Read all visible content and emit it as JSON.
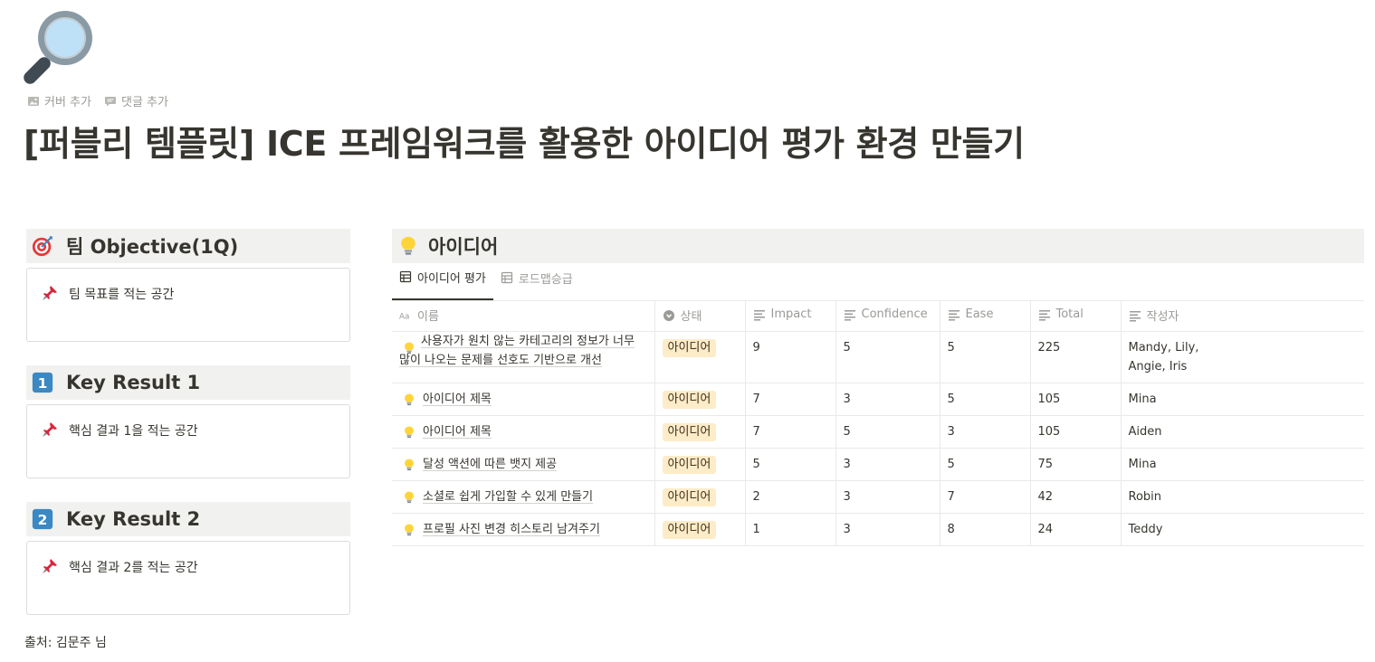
{
  "page": {
    "title": "[퍼블리 템플릿] ICE 프레임워크를 활용한 아이디어 평가 환경 만들기",
    "add_cover": "커버 추가",
    "add_comment": "댓글 추가",
    "icon": "magnifying-glass-icon"
  },
  "sections": [
    {
      "title": "팀 Objective(1Q)",
      "icon": "target-icon",
      "content": "팀 목표를 적는 공간"
    },
    {
      "title": "Key Result 1",
      "icon": "keycap-1-icon",
      "content": "핵심 결과 1을 적는 공간"
    },
    {
      "title": "Key Result 2",
      "icon": "keycap-2-icon",
      "content": "핵심 결과 2를 적는 공간"
    }
  ],
  "source": "출처: 김문주 님",
  "database": {
    "title": "아이디어",
    "icon": "light-bulb-icon",
    "tabs": [
      "아이디어 평가",
      "로드맵승급"
    ],
    "columns": [
      "이름",
      "상태",
      "Impact",
      "Confidence",
      "Ease",
      "Total",
      "작성자"
    ],
    "rows": [
      {
        "name": "사용자가 원치 않는 카테고리의 정보가 너무 많이 나오는 문제를 선호도 기반으로 개선",
        "status": "아이디어",
        "impact": "9",
        "confidence": "5",
        "ease": "5",
        "total": "225",
        "author": "Mandy, Lily, Angie, Iris"
      },
      {
        "name": "아이디어 제목",
        "status": "아이디어",
        "impact": "7",
        "confidence": "3",
        "ease": "5",
        "total": "105",
        "author": "Mina"
      },
      {
        "name": "아이디어 제목",
        "status": "아이디어",
        "impact": "7",
        "confidence": "5",
        "ease": "3",
        "total": "105",
        "author": "Aiden"
      },
      {
        "name": "달성 액션에 따른 뱃지 제공",
        "status": "아이디어",
        "impact": "5",
        "confidence": "3",
        "ease": "5",
        "total": "75",
        "author": "Mina"
      },
      {
        "name": "소셜로 쉽게 가입할 수 있게 만들기",
        "status": "아이디어",
        "impact": "2",
        "confidence": "3",
        "ease": "7",
        "total": "42",
        "author": "Robin"
      },
      {
        "name": "프로필 사진 변경 히스토리 남겨주기",
        "status": "아이디어",
        "impact": "1",
        "confidence": "3",
        "ease": "8",
        "total": "24",
        "author": "Teddy"
      }
    ]
  },
  "colors": {
    "text": "#37352f",
    "muted": "#9b9a97",
    "section_bg": "#f1f1ef",
    "tag_bg": "#fdecc8",
    "border": "#e9e9e7"
  }
}
